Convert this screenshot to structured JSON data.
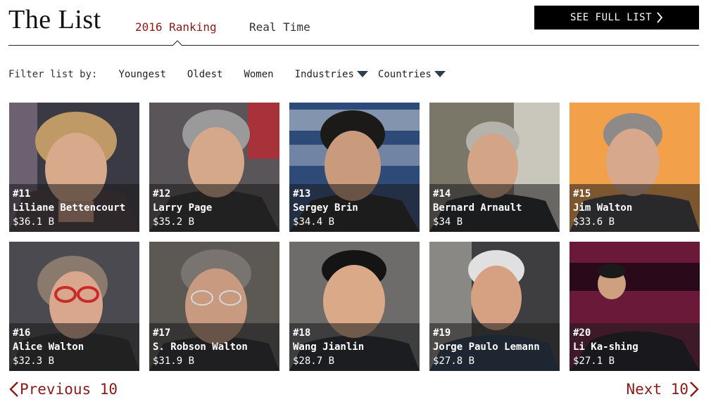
{
  "header": {
    "title": "The List",
    "tabs": [
      {
        "label": "2016 Ranking",
        "active": true
      },
      {
        "label": "Real Time",
        "active": false
      }
    ],
    "see_full_list": "SEE FULL LIST",
    "accent_color": "#8b1a1a"
  },
  "filters": {
    "label": "Filter list by:",
    "options": [
      "Youngest",
      "Oldest",
      "Women"
    ],
    "dropdowns": [
      "Industries",
      "Countries"
    ]
  },
  "people": [
    {
      "rank": "#11",
      "name": "Liliane Bettencourt",
      "worth": "$36.1 B"
    },
    {
      "rank": "#12",
      "name": "Larry Page",
      "worth": "$35.2 B"
    },
    {
      "rank": "#13",
      "name": "Sergey Brin",
      "worth": "$34.4 B"
    },
    {
      "rank": "#14",
      "name": "Bernard Arnault",
      "worth": "$34 B"
    },
    {
      "rank": "#15",
      "name": "Jim Walton",
      "worth": "$33.6 B"
    },
    {
      "rank": "#16",
      "name": "Alice Walton",
      "worth": "$32.3 B"
    },
    {
      "rank": "#17",
      "name": "S. Robson Walton",
      "worth": "$31.9 B"
    },
    {
      "rank": "#18",
      "name": "Wang Jianlin",
      "worth": "$28.7 B"
    },
    {
      "rank": "#19",
      "name": "Jorge Paulo Lemann",
      "worth": "$27.8 B"
    },
    {
      "rank": "#20",
      "name": "Li Ka-shing",
      "worth": "$27.1 B"
    }
  ],
  "pagination": {
    "previous": "Previous 10",
    "next": "Next 10"
  }
}
